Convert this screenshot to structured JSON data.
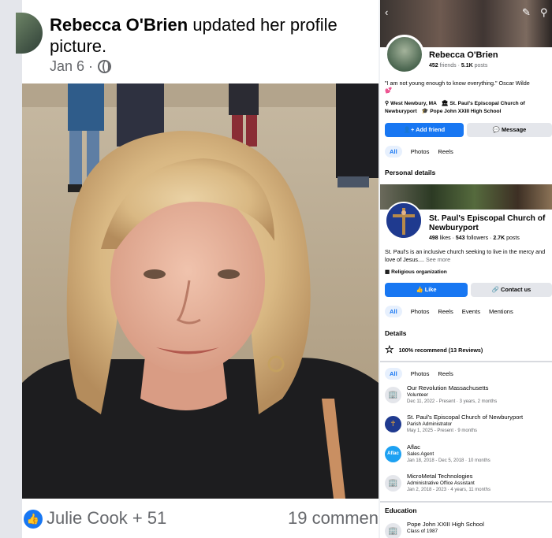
{
  "post": {
    "author": "Rebecca O'Brien",
    "action": " updated her profile picture.",
    "date": "Jan 6 ·",
    "reactors": "Julie Cook + 51",
    "comments": "19 commen"
  },
  "profile": {
    "name": "Rebecca O'Brien",
    "friends": "452",
    "friends_label": " friends · ",
    "posts": "5.1K",
    "posts_label": " posts",
    "quote": "\"I am not young enough to know everything.\" Oscar Wilde",
    "location": "West Newbury, MA",
    "workplace": "St. Paul's Episcopal Church of Newburyport",
    "school": "Pope John XXIII High School",
    "add_friend": "Add friend",
    "message": "Message",
    "tabs": [
      "All",
      "Photos",
      "Reels"
    ],
    "section_title": "Personal details"
  },
  "church": {
    "name": "St. Paul's Episcopal Church of Newburyport",
    "likes": "498",
    "likes_label": " likes · ",
    "followers": "543",
    "followers_label": " followers · ",
    "talking": "2.7K",
    "talking_label": " posts",
    "description": "St. Paul's is an inclusive church seeking to live in the mercy and love of Jesus....",
    "see_more": "See more",
    "category": "Religious organization",
    "like_button": "Like",
    "contact_button": "Contact us",
    "tabs": [
      "All",
      "Photos",
      "Reels",
      "Events",
      "Mentions"
    ],
    "details_title": "Details",
    "recommend": "100% recommend (13 Reviews)"
  },
  "work_tabs": [
    "All",
    "Photos",
    "Reels"
  ],
  "work": [
    {
      "title": "Our Revolution Massachusetts",
      "role": "Volunteer",
      "date": "Dec 11, 2022 - Present · 3 years, 2 months"
    },
    {
      "title": "St. Paul's Episcopal Church of Newburyport",
      "role": "Parish Administrator",
      "date": "May 1, 2025 - Present · 9 months"
    },
    {
      "title": "Aflac",
      "role": "Sales Agent",
      "date": "Jan 18, 2018 - Dec 5, 2018 · 10 months"
    },
    {
      "title": "MicroMetal Technologies",
      "role": "Administrative Office Assistant",
      "date": "Jan 2, 2018 - 2023 · 4 years, 11 months"
    }
  ],
  "education": {
    "title": "Education",
    "school": "Pope John XXIII High School",
    "class": "Class of 1987"
  },
  "aflac_logo": "Aflac",
  "colors": {
    "accent": "#1877f2",
    "text": "#050505",
    "muted": "#65676b"
  }
}
